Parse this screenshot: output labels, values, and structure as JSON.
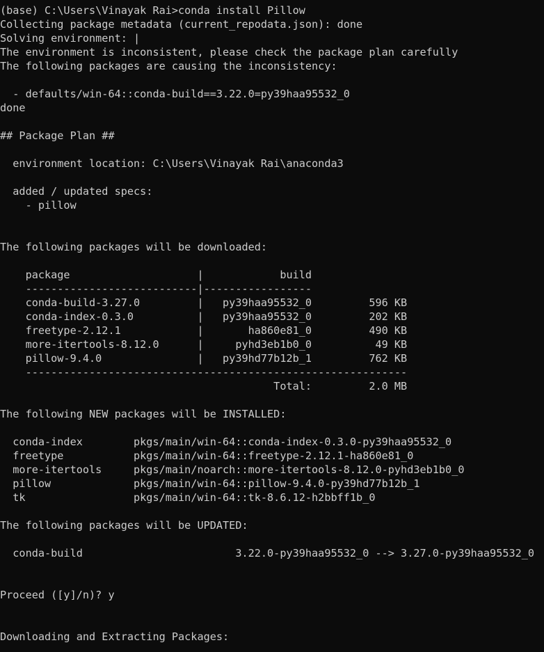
{
  "terminal": {
    "background": "#0c0c0c",
    "foreground": "#cccccc",
    "lines": [
      "(base) C:\\Users\\Vinayak Rai>conda install Pillow",
      "Collecting package metadata (current_repodata.json): done",
      "Solving environment: |",
      "The environment is inconsistent, please check the package plan carefully",
      "The following packages are causing the inconsistency:",
      "",
      "  - defaults/win-64::conda-build==3.22.0=py39haa95532_0",
      "done",
      "",
      "## Package Plan ##",
      "",
      "  environment location: C:\\Users\\Vinayak Rai\\anaconda3",
      "",
      "  added / updated specs:",
      "    - pillow",
      "",
      "",
      "The following packages will be downloaded:",
      "",
      "    package                    |            build",
      "    ---------------------------|-----------------",
      "    conda-build-3.27.0         |   py39haa95532_0         596 KB",
      "    conda-index-0.3.0          |   py39haa95532_0         202 KB",
      "    freetype-2.12.1            |       ha860e81_0         490 KB",
      "    more-itertools-8.12.0      |     pyhd3eb1b0_0          49 KB",
      "    pillow-9.4.0               |   py39hd77b12b_1         762 KB",
      "    ------------------------------------------------------------",
      "                                           Total:         2.0 MB",
      "",
      "The following NEW packages will be INSTALLED:",
      "",
      "  conda-index        pkgs/main/win-64::conda-index-0.3.0-py39haa95532_0",
      "  freetype           pkgs/main/win-64::freetype-2.12.1-ha860e81_0",
      "  more-itertools     pkgs/main/noarch::more-itertools-8.12.0-pyhd3eb1b0_0",
      "  pillow             pkgs/main/win-64::pillow-9.4.0-py39hd77b12b_1",
      "  tk                 pkgs/main/win-64::tk-8.6.12-h2bbff1b_0",
      "",
      "The following packages will be UPDATED:",
      "",
      "  conda-build                        3.22.0-py39haa95532_0 --> 3.27.0-py39haa95532_0",
      "",
      "",
      "Proceed ([y]/n)? y",
      "",
      "",
      "Downloading and Extracting Packages:"
    ]
  }
}
